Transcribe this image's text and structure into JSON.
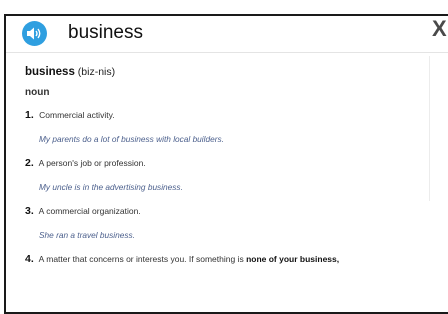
{
  "header": {
    "word": "business",
    "speaker_icon": "speaker-audio-icon",
    "close_label": "X"
  },
  "entry": {
    "headword": "business",
    "pronunciation": "(biz-nis)",
    "part_of_speech": "noun",
    "senses": [
      {
        "number": "1.",
        "definition": "Commercial activity.",
        "example": "My parents do a lot of business with local builders."
      },
      {
        "number": "2.",
        "definition": "A person's job or profession.",
        "example": "My uncle is in the advertising business."
      },
      {
        "number": "3.",
        "definition": "A commercial organization.",
        "example": "She ran a travel business."
      },
      {
        "number": "4.",
        "definition": "A matter that concerns or interests you. If something is ",
        "definition_bold": "none of your business,"
      }
    ]
  },
  "colors": {
    "speaker_background": "#2f9fe0",
    "example_text": "#4b5f8c",
    "border": "#1a1a1a"
  }
}
